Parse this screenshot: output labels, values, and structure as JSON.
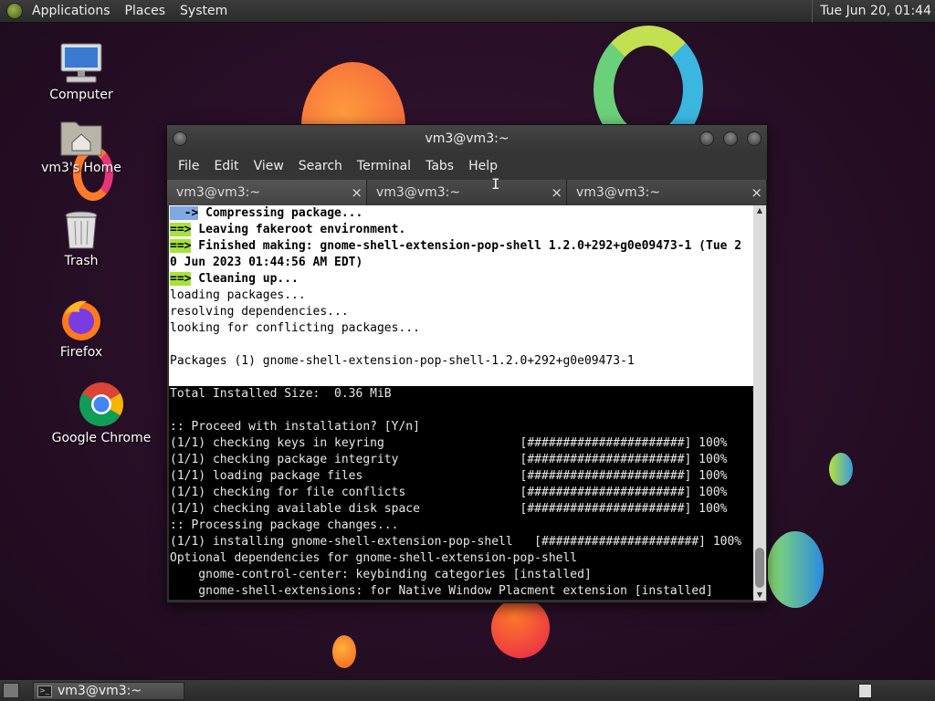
{
  "top_panel": {
    "menus": [
      "Applications",
      "Places",
      "System"
    ],
    "clock": "Tue Jun 20, 01:44"
  },
  "desktop_icons": [
    {
      "label": "Computer",
      "icon": "computer-icon"
    },
    {
      "label": "vm3's Home",
      "icon": "home-folder-icon"
    },
    {
      "label": "Trash",
      "icon": "trash-icon"
    },
    {
      "label": "Firefox",
      "icon": "firefox-icon"
    },
    {
      "label": "Google Chrome",
      "icon": "chrome-icon"
    }
  ],
  "terminal": {
    "title": "vm3@vm3:~",
    "menu": [
      "File",
      "Edit",
      "View",
      "Search",
      "Terminal",
      "Tabs",
      "Help"
    ],
    "tabs": [
      "vm3@vm3:~",
      "vm3@vm3:~",
      "vm3@vm3:~"
    ],
    "tab_close": "×",
    "lines": [
      {
        "bg": "light",
        "prefix": "  ->",
        "prefix_style": "arrow-b",
        "text": " Compressing package...",
        "bold": true
      },
      {
        "bg": "light",
        "prefix": "==>",
        "prefix_style": "arrow-g",
        "text": " Leaving fakeroot environment.",
        "bold": true
      },
      {
        "bg": "light",
        "prefix": "==>",
        "prefix_style": "arrow-g",
        "text": " Finished making: gnome-shell-extension-pop-shell 1.2.0+292+g0e09473-1 (Tue 2",
        "bold": true
      },
      {
        "bg": "light",
        "prefix": "",
        "prefix_style": "",
        "text": "0 Jun 2023 01:44:56 AM EDT)",
        "bold": true
      },
      {
        "bg": "light",
        "prefix": "==>",
        "prefix_style": "arrow-g",
        "text": " Cleaning up...",
        "bold": true
      },
      {
        "bg": "light",
        "prefix": "",
        "prefix_style": "",
        "text": "loading packages...",
        "bold": false
      },
      {
        "bg": "light",
        "prefix": "",
        "prefix_style": "",
        "text": "resolving dependencies...",
        "bold": false
      },
      {
        "bg": "light",
        "prefix": "",
        "prefix_style": "",
        "text": "looking for conflicting packages...",
        "bold": false
      },
      {
        "bg": "light",
        "prefix": "",
        "prefix_style": "",
        "text": "",
        "bold": false
      },
      {
        "bg": "light",
        "prefix": "",
        "prefix_style": "",
        "text": "Packages (1) gnome-shell-extension-pop-shell-1.2.0+292+g0e09473-1",
        "bold": false
      },
      {
        "bg": "light",
        "prefix": "",
        "prefix_style": "",
        "text": "",
        "bold": false
      },
      {
        "bg": "dark",
        "prefix": "",
        "prefix_style": "",
        "text": "Total Installed Size:  0.36 MiB",
        "bold": false
      },
      {
        "bg": "dark",
        "prefix": "",
        "prefix_style": "",
        "text": "",
        "bold": false
      },
      {
        "bg": "dark",
        "prefix": "",
        "prefix_style": "",
        "text": ":: Proceed with installation? [Y/n]",
        "bold": false
      },
      {
        "bg": "dark",
        "prefix": "",
        "prefix_style": "",
        "text": "(1/1) checking keys in keyring                   [######################] 100%",
        "bold": false
      },
      {
        "bg": "dark",
        "prefix": "",
        "prefix_style": "",
        "text": "(1/1) checking package integrity                 [######################] 100%",
        "bold": false
      },
      {
        "bg": "dark",
        "prefix": "",
        "prefix_style": "",
        "text": "(1/1) loading package files                      [######################] 100%",
        "bold": false
      },
      {
        "bg": "dark",
        "prefix": "",
        "prefix_style": "",
        "text": "(1/1) checking for file conflicts                [######################] 100%",
        "bold": false
      },
      {
        "bg": "dark",
        "prefix": "",
        "prefix_style": "",
        "text": "(1/1) checking available disk space              [######################] 100%",
        "bold": false
      },
      {
        "bg": "dark",
        "prefix": "",
        "prefix_style": "",
        "text": ":: Processing package changes...",
        "bold": false
      },
      {
        "bg": "dark",
        "prefix": "",
        "prefix_style": "",
        "text": "(1/1) installing gnome-shell-extension-pop-shell   [######################] 100%",
        "bold": false
      },
      {
        "bg": "dark",
        "prefix": "",
        "prefix_style": "",
        "text": "Optional dependencies for gnome-shell-extension-pop-shell",
        "bold": false
      },
      {
        "bg": "dark",
        "prefix": "",
        "prefix_style": "",
        "text": "    gnome-control-center: keybinding categories [installed]",
        "bold": false
      },
      {
        "bg": "dark",
        "prefix": "",
        "prefix_style": "",
        "text": "    gnome-shell-extensions: for Native Window Placment extension [installed]",
        "bold": false
      }
    ]
  },
  "bottom_panel": {
    "taskbar_item": "vm3@vm3:~"
  },
  "colors": {
    "green_arrow": "#a7e23a",
    "blue_arrow": "#7fa9e0"
  }
}
